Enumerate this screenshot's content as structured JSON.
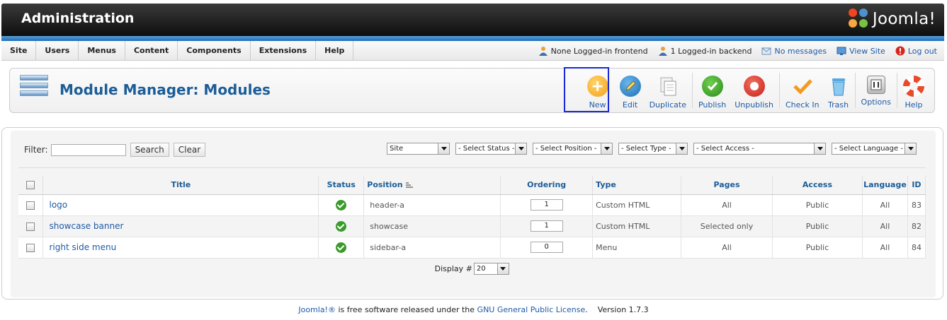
{
  "header": {
    "title": "Administration",
    "logo_text": "Joomla!"
  },
  "menu": [
    "Site",
    "Users",
    "Menus",
    "Content",
    "Components",
    "Extensions",
    "Help"
  ],
  "status": {
    "frontend": "None Logged-in frontend",
    "backend": "1 Logged-in backend",
    "messages": "No messages",
    "view_site": "View Site",
    "logout": "Log out"
  },
  "page": {
    "title": "Module Manager: Modules"
  },
  "toolbar": {
    "new": "New",
    "edit": "Edit",
    "duplicate": "Duplicate",
    "publish": "Publish",
    "unpublish": "Unpublish",
    "checkin": "Check In",
    "trash": "Trash",
    "options": "Options",
    "help": "Help"
  },
  "filter": {
    "label": "Filter:",
    "value": "",
    "search": "Search",
    "clear": "Clear",
    "site": "Site",
    "status": "- Select Status -",
    "position": "- Select Position -",
    "type": "- Select Type -",
    "access": "- Select Access -",
    "language": "- Select Language -"
  },
  "table": {
    "headers": {
      "title": "Title",
      "status": "Status",
      "position": "Position",
      "ordering": "Ordering",
      "type": "Type",
      "pages": "Pages",
      "access": "Access",
      "language": "Language",
      "id": "ID"
    },
    "rows": [
      {
        "title": "logo",
        "position": "header-a",
        "ordering": "1",
        "type": "Custom HTML",
        "pages": "All",
        "access": "Public",
        "language": "All",
        "id": "83"
      },
      {
        "title": "showcase banner",
        "position": "showcase",
        "ordering": "1",
        "type": "Custom HTML",
        "pages": "Selected only",
        "access": "Public",
        "language": "All",
        "id": "82"
      },
      {
        "title": "right side menu",
        "position": "sidebar-a",
        "ordering": "0",
        "type": "Menu",
        "pages": "All",
        "access": "Public",
        "language": "All",
        "id": "84"
      }
    ],
    "display_label": "Display #",
    "display_value": "20"
  },
  "footer": {
    "joomla": "Joomla!®",
    "text1": " is free software released under the ",
    "license": "GNU General Public License",
    "text2": ".",
    "version": "Version 1.7.3"
  }
}
